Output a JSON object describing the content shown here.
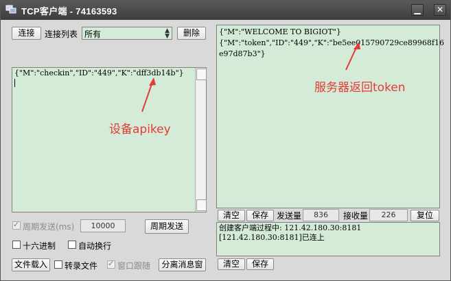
{
  "window": {
    "title": "TCP客户端 - 74163593",
    "minimize_glyph": "▁",
    "close_glyph": "✕"
  },
  "left": {
    "connect_button": "连接",
    "connection_list_label": "连接列表",
    "connection_select_value": "所有",
    "delete_button": "删除",
    "send_text": "{\"M\":\"checkin\",\"ID\":\"449\",\"K\":\"dff3db14b\"}",
    "periodic_send_label": "周期发送(ms)",
    "periodic_value": "10000",
    "periodic_send_button": "周期发送",
    "hex_label": "十六进制",
    "auto_wrap_label": "自动换行",
    "load_file_button": "文件载入",
    "record_file_label": "转录文件",
    "window_follow_label": "窗口跟随",
    "separate_msg_button": "分离消息窗"
  },
  "right": {
    "receive_lines": [
      "{\"M\":\"WELCOME TO BIGIOT\"}",
      "{\"M\":\"token\",\"ID\":\"449\",\"K\":\"be5ee015790729ce89968f16",
      "e97d87b3\"}"
    ],
    "clear_button": "清空",
    "save_button": "保存",
    "sent_label": "发送量",
    "sent_value": "836",
    "received_label": "接收量",
    "received_value": "226",
    "reset_button": "复位",
    "log_lines": [
      "创建客户端过程中: 121.42.180.30:8181",
      "[121.42.180.30:8181]已连上"
    ],
    "clear_button_2": "清空",
    "save_button_2": "保存"
  },
  "annotations": {
    "device_apikey": "设备apikey",
    "server_token": "服务器返回token",
    "color": "#e53935"
  }
}
